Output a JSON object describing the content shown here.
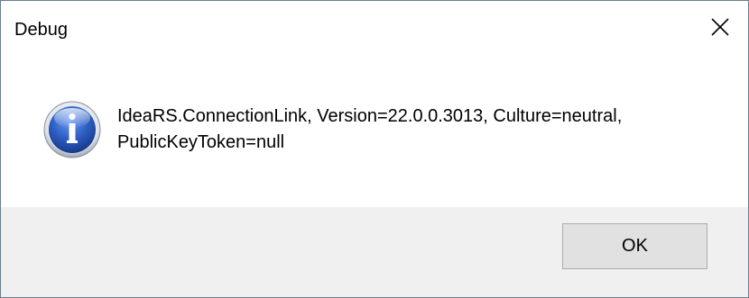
{
  "dialog": {
    "title": "Debug",
    "close_icon": "close-icon",
    "icon": "info-icon",
    "message_lines": [
      "IdeaRS.ConnectionLink, Version=22.0.0.3013, Culture=neutral,",
      "PublicKeyToken=null"
    ],
    "ok_label": "OK"
  },
  "colors": {
    "window_bg": "#ffffff",
    "footer_bg": "#f0f0f0",
    "button_bg": "#e1e1e1",
    "button_border": "#adadad",
    "icon_blue": "#2a55b8",
    "border": "#6b7d8c"
  }
}
